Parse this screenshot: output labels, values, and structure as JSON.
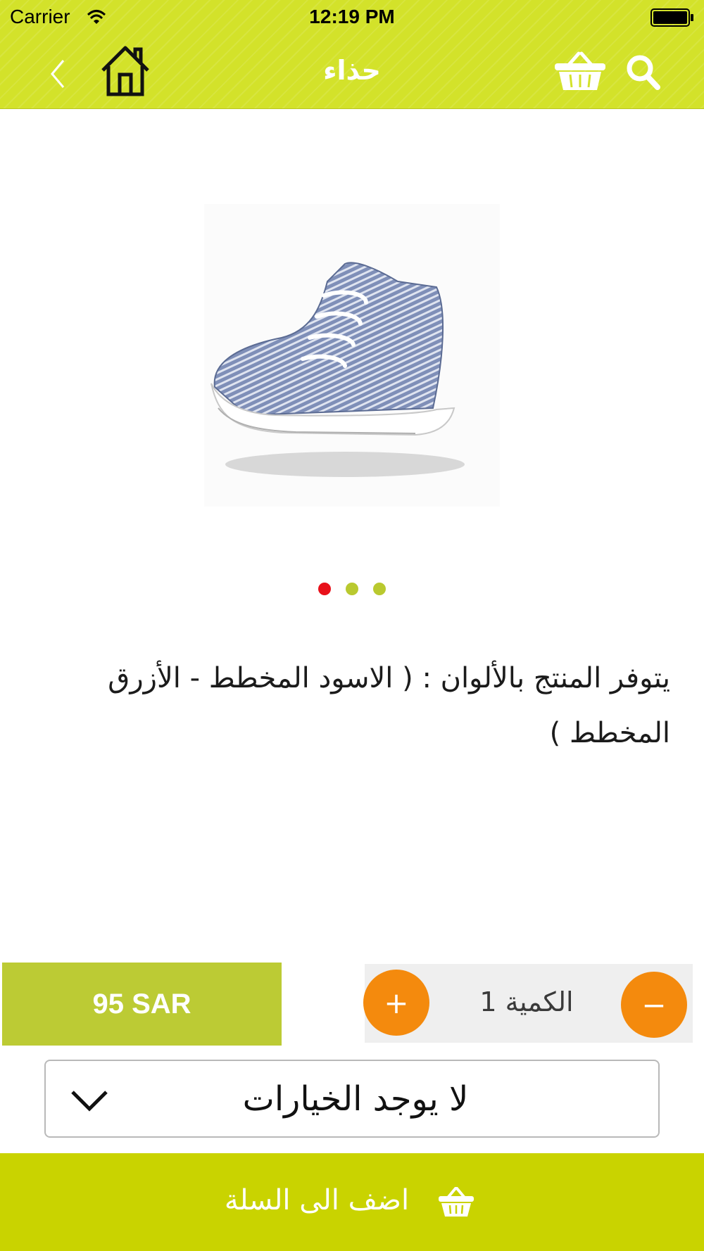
{
  "status_bar": {
    "carrier": "Carrier",
    "time": "12:19 PM"
  },
  "header": {
    "title": "حذاء",
    "icons": [
      "back-chevron-icon",
      "home-icon",
      "cart-basket-icon",
      "search-icon"
    ]
  },
  "carousel": {
    "page_count": 3,
    "active_index": 0,
    "active_color": "#e8101a",
    "inactive_color": "#b9c92f"
  },
  "product": {
    "description": "يتوفر المنتج بالألوان : ( الاسود المخطط - الأزرق المخطط )",
    "price": "95 SAR"
  },
  "quantity": {
    "label": "الكمية 1",
    "plus_symbol": "+",
    "minus_symbol": "−"
  },
  "options": {
    "selected_text": "لا يوجد الخيارات"
  },
  "add_to_cart": {
    "label": "اضف الى السلة"
  },
  "colors": {
    "brand_green": "#d3e22a",
    "price_bg": "#bccb34",
    "cta_bg": "#c9d300",
    "accent_orange": "#f48a0d"
  }
}
